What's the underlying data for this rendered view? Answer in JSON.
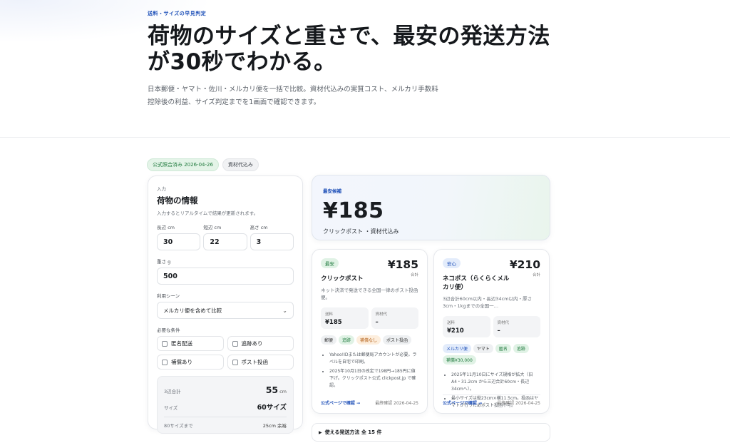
{
  "hero": {
    "eyebrow": "送料・サイズの早見判定",
    "title": "荷物のサイズと重さで、最安の発送方法が30秒でわかる。",
    "description": "日本郵便・ヤマト・佐川・メルカリ便を一括で比較。資材代込みの実質コスト、メルカリ手数料控除後の利益、サイズ判定までを1画面で確認できます。"
  },
  "badges": {
    "official": "公式照合済み 2026-04-26",
    "materials": "資材代込み"
  },
  "input": {
    "section_label": "入力",
    "title": "荷物の情報",
    "subtitle": "入力するとリアルタイムで結果が更新されます。",
    "long_label": "長辺 cm",
    "long_value": "30",
    "short_label": "短辺 cm",
    "short_value": "22",
    "height_label": "高さ cm",
    "height_value": "3",
    "weight_label": "重さ g",
    "weight_value": "500",
    "scene_label": "利用シーン",
    "scene_value": "メルカリ便を含めて比較",
    "conditions_label": "必要な条件",
    "conditions": [
      "匿名配送",
      "追跡あり",
      "補償あり",
      "ポスト投函"
    ],
    "summary": {
      "sum3_label": "3辺合計",
      "sum3_value": "55",
      "sum3_unit": "cm",
      "size_label": "サイズ",
      "size_value": "60サイズ",
      "until_label": "80サイズまで",
      "until_value": "25cm 余裕"
    }
  },
  "best": {
    "label": "最安候補",
    "price": "¥185",
    "name": "クリックポスト ・資材代込み"
  },
  "options": [
    {
      "tag": "最安",
      "price": "¥185",
      "total": "合計",
      "name": "クリックポスト",
      "desc": "ネット決済で発送できる全国一律のポスト投函便。",
      "fee_label": "送料",
      "fee_value": "¥185",
      "material_label": "資材代",
      "material_value": "–",
      "chips": [
        "郵便",
        "追跡",
        "補償なし",
        "ポスト投函"
      ],
      "notes": [
        "Yahoo!IDまたは郵便局アカウントが必要。ラベルを自宅で印刷。",
        "2025年10月1日の改定で198円→185円に値下げ。クリックポスト公式 clickpost.jp で確認。"
      ],
      "link": "公式ページで確認 →",
      "checked": "最終確認 2026-04-25"
    },
    {
      "tag": "安心",
      "price": "¥210",
      "total": "合計",
      "name": "ネコポス（らくらくメルカリ便）",
      "desc": "3辺合計60cm以内・長辺34cm以内・厚さ3cm・1kgまでの全国一…",
      "fee_label": "送料",
      "fee_value": "¥210",
      "material_label": "資材代",
      "material_value": "–",
      "chips": [
        "メルカリ便",
        "ヤマト",
        "匿名",
        "追跡",
        "補償¥30,000"
      ],
      "notes": [
        "2025年11月10日にサイズ規格が拡大（旧A4・31.2cm から三辺合計60cm・長辺34cmへ）。",
        "最小サイズは縦23cm×横11.5cm。投函はヤマトが行うためポスト投函不可。"
      ],
      "link": "公式ページで確認 →",
      "checked": "最終確認 2026-04-25"
    }
  ],
  "methods_toggle": "使える発送方法 全 15 件"
}
